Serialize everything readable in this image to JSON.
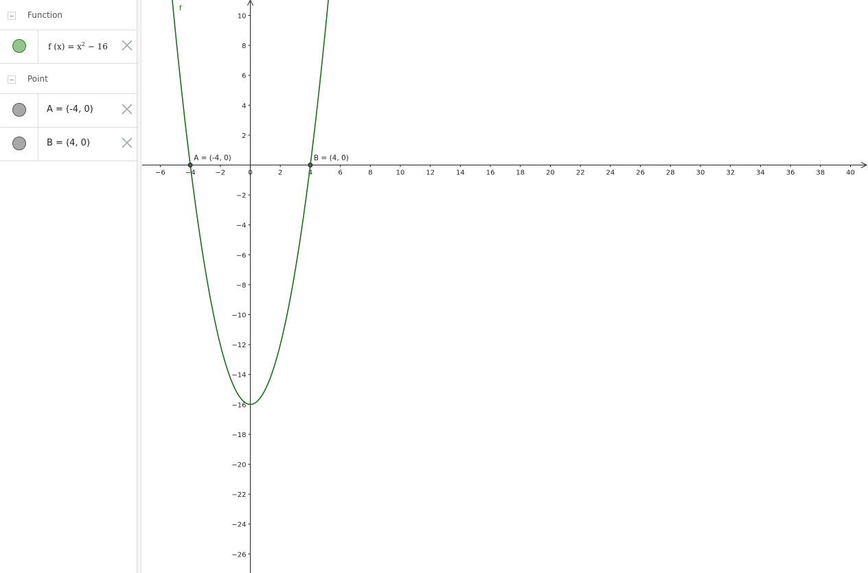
{
  "algebra_view": {
    "function_group": {
      "label": "Function",
      "items": [
        {
          "name": "f",
          "formula_prefix": "f (x)  =  x",
          "exponent": "2",
          "formula_suffix": " − 16",
          "color": "#93c68b"
        }
      ]
    },
    "point_group": {
      "label": "Point",
      "items": [
        {
          "text": "A = (-4, 0)",
          "color": "#a8a8a8"
        },
        {
          "text": "B = (4, 0)",
          "color": "#a8a8a8"
        }
      ]
    }
  },
  "graphics_view": {
    "curve_label": "f",
    "point_labels": [
      "A = (-4, 0)",
      "B = (4, 0)"
    ]
  },
  "chart_data": {
    "type": "line",
    "title": "",
    "xlabel": "",
    "ylabel": "",
    "grid": false,
    "xlim": [
      -7.2,
      40.8
    ],
    "ylim": [
      -27.2,
      11
    ],
    "x_ticks": [
      -6,
      -4,
      -2,
      0,
      2,
      4,
      6,
      8,
      10,
      12,
      14,
      16,
      18,
      20,
      22,
      24,
      26,
      28,
      30,
      32,
      34,
      36,
      38,
      40
    ],
    "y_ticks": [
      10,
      8,
      6,
      4,
      2,
      -2,
      -4,
      -6,
      -8,
      -10,
      -12,
      -14,
      -16,
      -18,
      -20,
      -22,
      -24,
      -26
    ],
    "series": [
      {
        "name": "f",
        "expression": "x^2 - 16",
        "color": "#1e6b1e"
      }
    ],
    "points": [
      {
        "name": "A",
        "x": -4,
        "y": 0,
        "label": "A = (-4, 0)"
      },
      {
        "name": "B",
        "x": 4,
        "y": 0,
        "label": "B = (4, 0)"
      }
    ]
  }
}
